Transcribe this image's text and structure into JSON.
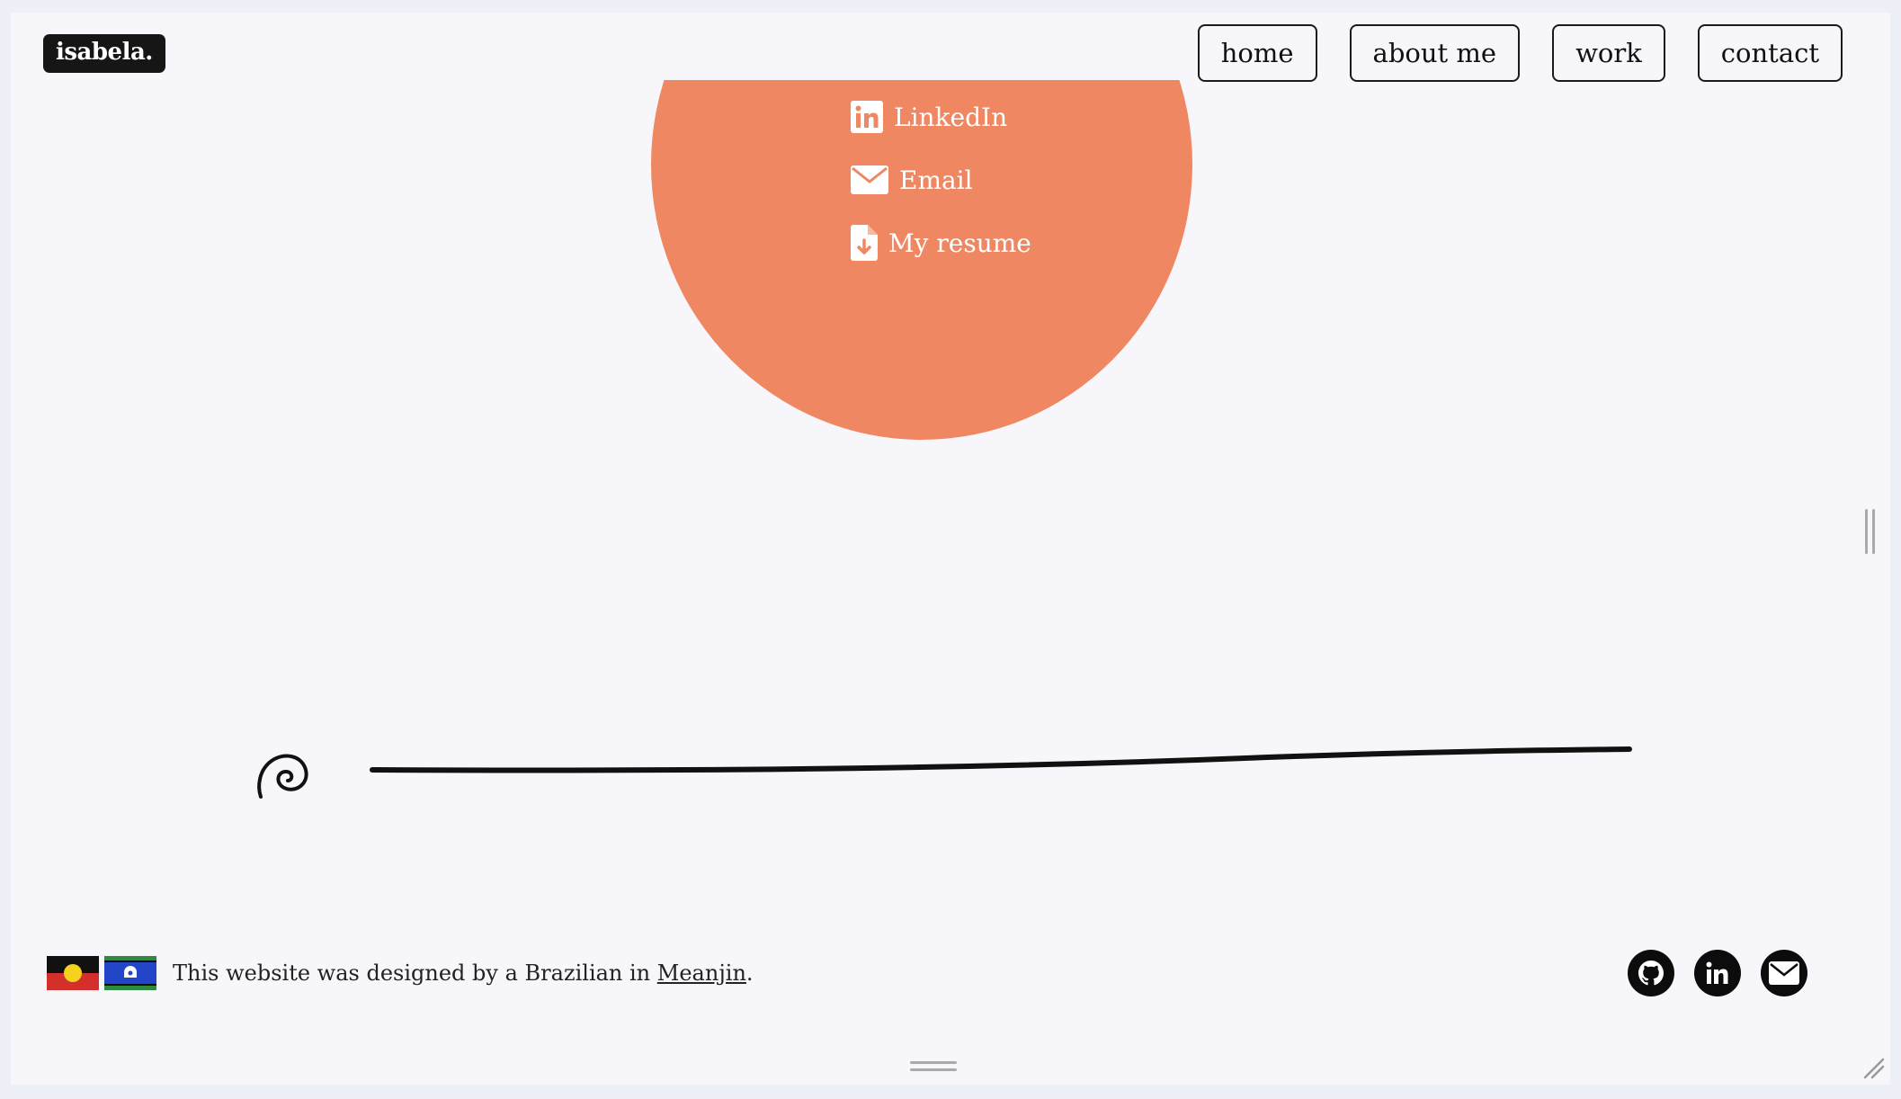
{
  "header": {
    "logo_text": "isabela.",
    "nav": [
      {
        "label": "home"
      },
      {
        "label": "about me"
      },
      {
        "label": "work"
      },
      {
        "label": "contact"
      }
    ]
  },
  "contact_section": {
    "accent_color": "#ef8862",
    "links": [
      {
        "label": "LinkedIn",
        "icon": "linkedin-icon"
      },
      {
        "label": "Email",
        "icon": "envelope-icon"
      },
      {
        "label": "My resume",
        "icon": "file-download-icon"
      }
    ]
  },
  "footer": {
    "credit_prefix": "This website was designed by a Brazilian in ",
    "credit_link": "Meanjin",
    "credit_suffix": ".",
    "flags": [
      "aboriginal-flag",
      "torres-strait-islander-flag"
    ],
    "social_icons": [
      "github-icon",
      "linkedin-icon",
      "envelope-icon"
    ]
  }
}
